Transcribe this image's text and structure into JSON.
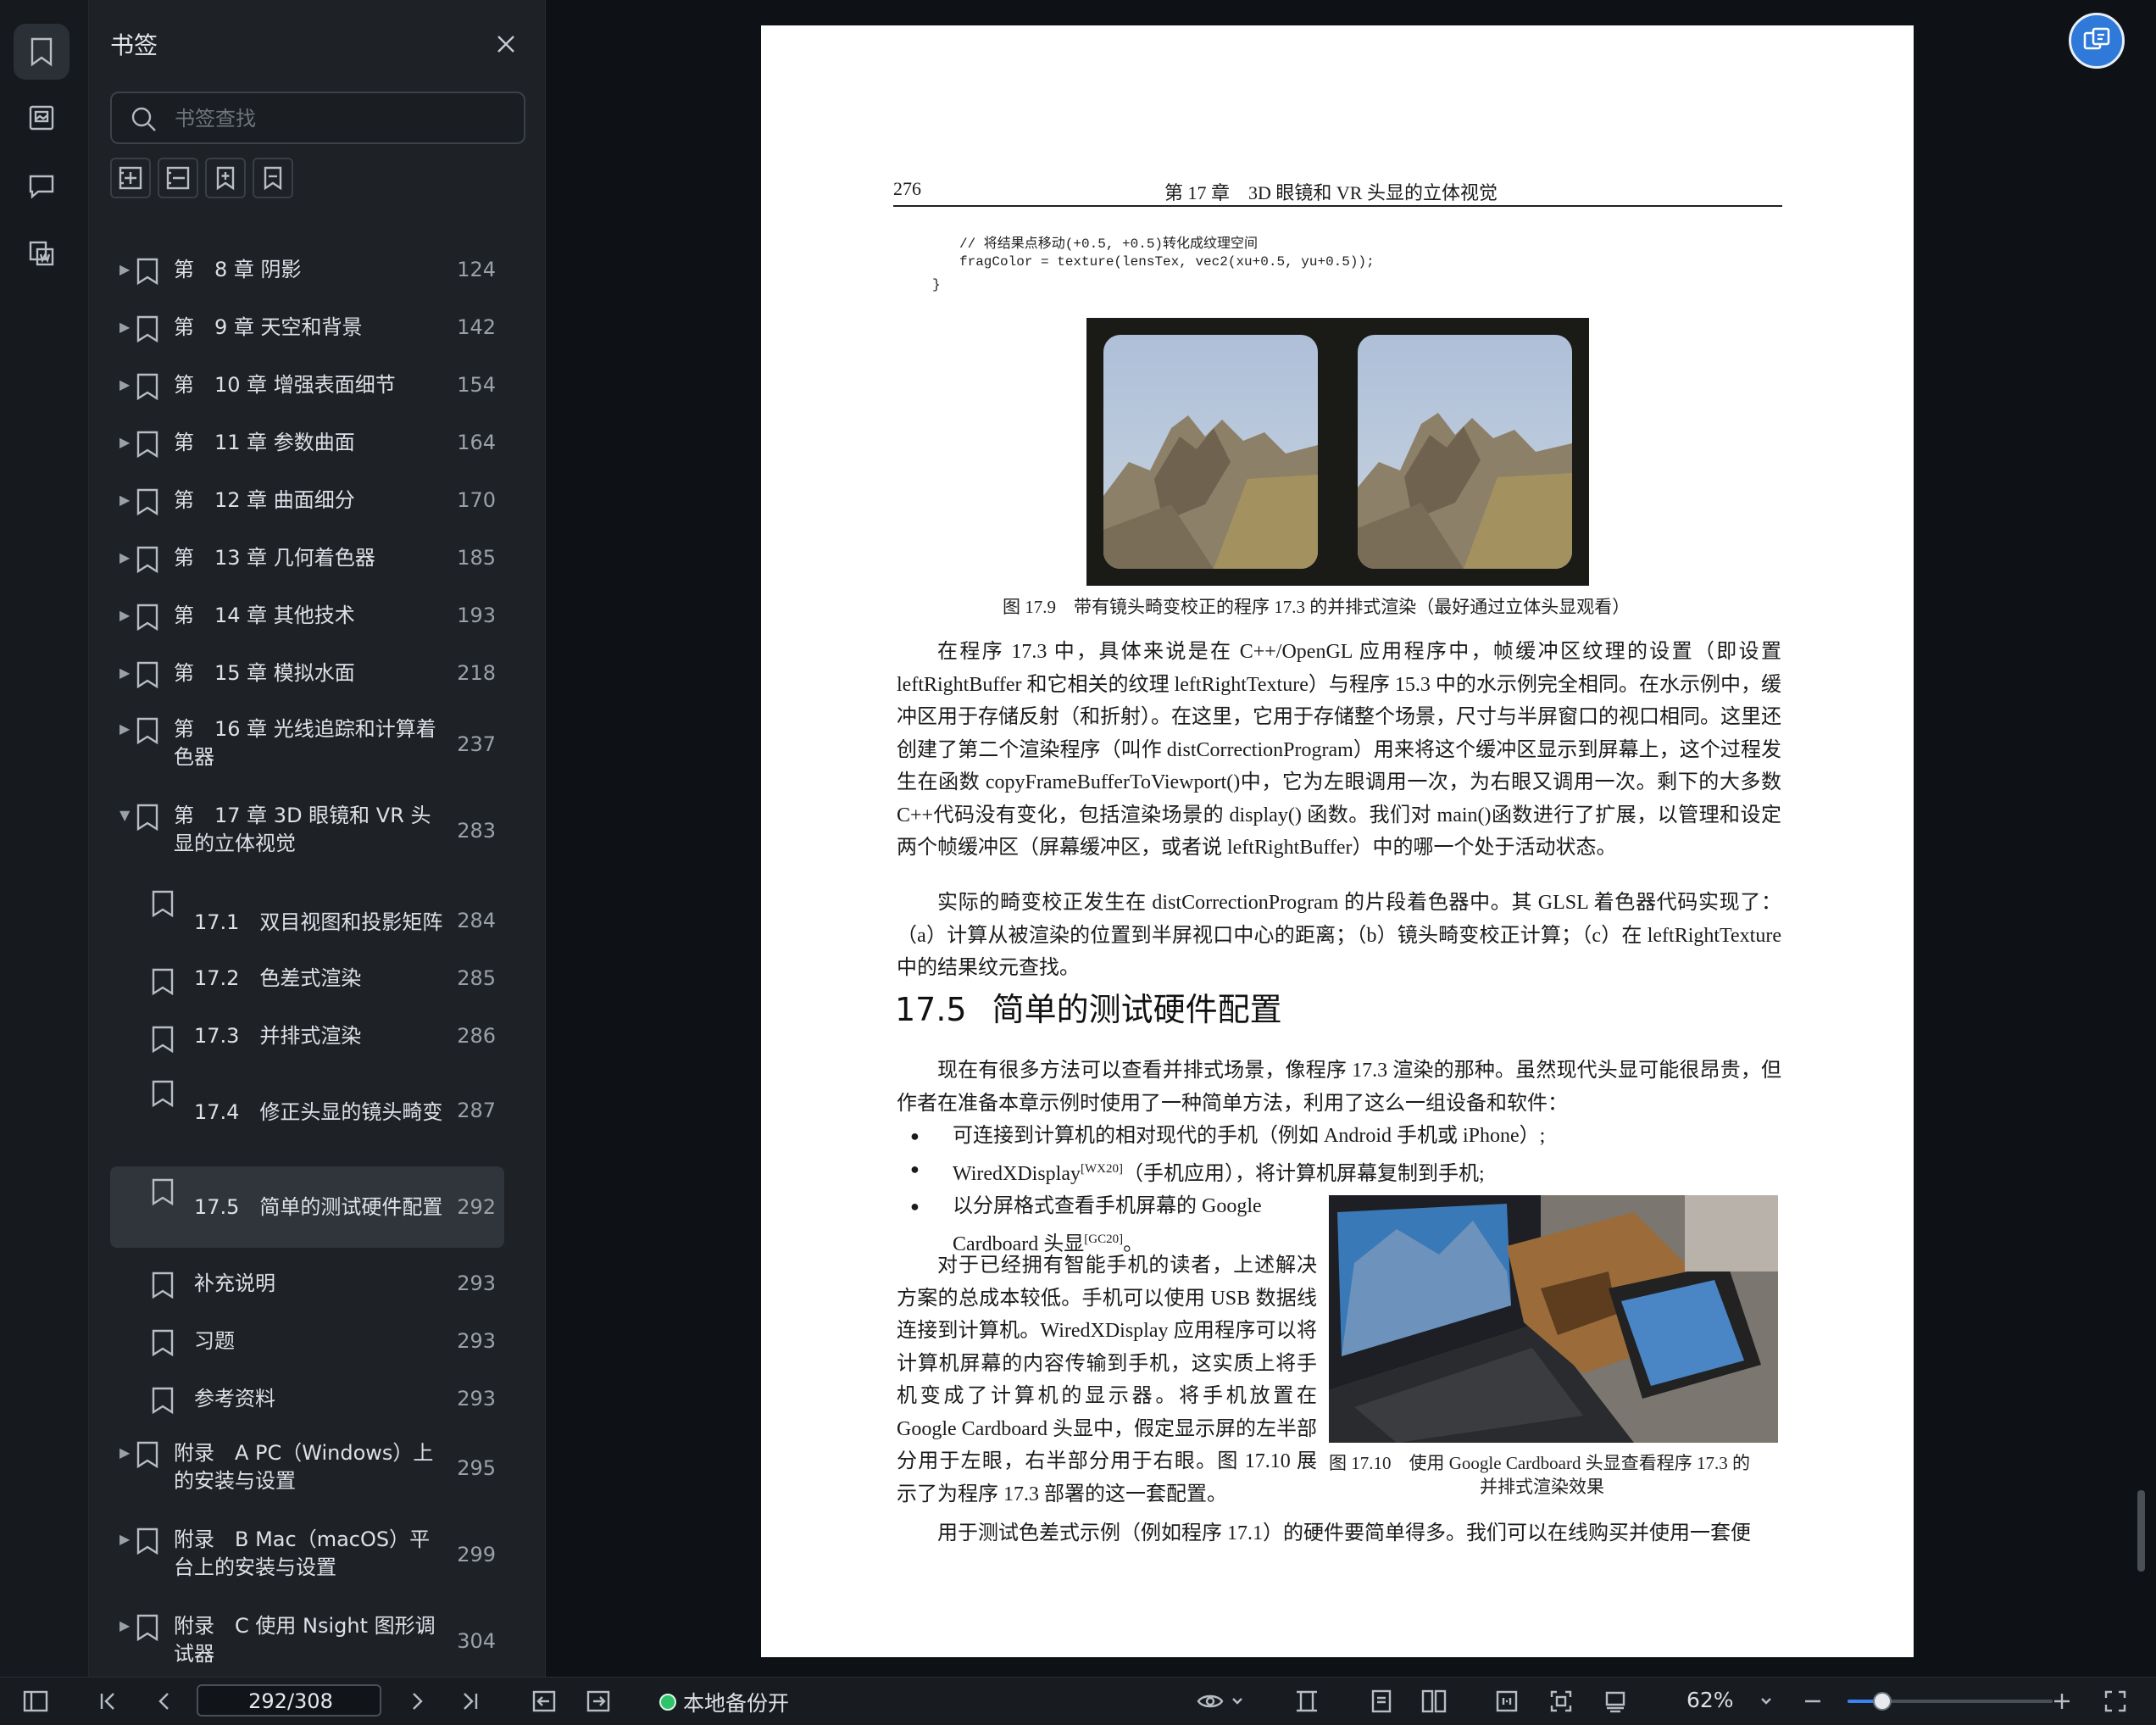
{
  "sidebar": {
    "title": "书签",
    "search_placeholder": "书签查找",
    "items": [
      {
        "label": "第　8 章 阴影",
        "page": "124"
      },
      {
        "label": "第　9 章 天空和背景",
        "page": "142"
      },
      {
        "label": "第　10 章 增强表面细节",
        "page": "154"
      },
      {
        "label": "第　11 章 参数曲面",
        "page": "164"
      },
      {
        "label": "第　12 章 曲面细分",
        "page": "170"
      },
      {
        "label": "第　13 章 几何着色器",
        "page": "185"
      },
      {
        "label": "第　14 章 其他技术",
        "page": "193"
      },
      {
        "label": "第　15 章 模拟水面",
        "page": "218"
      },
      {
        "label": "第　16 章 光线追踪和计算着色器",
        "page": "237"
      },
      {
        "label": "第　17 章 3D 眼镜和 VR 头显的立体视觉",
        "page": "283"
      },
      {
        "label": "17.1　双目视图和投影矩阵",
        "page": "284"
      },
      {
        "label": "17.2　色差式渲染",
        "page": "285"
      },
      {
        "label": "17.3　并排式渲染",
        "page": "286"
      },
      {
        "label": "17.4　修正头显的镜头畸变",
        "page": "287"
      },
      {
        "label": "17.5　简单的测试硬件配置",
        "page": "292"
      },
      {
        "label": "补充说明",
        "page": "293"
      },
      {
        "label": "习题",
        "page": "293"
      },
      {
        "label": "参考资料",
        "page": "293"
      },
      {
        "label": "附录　A PC（Windows）上的安装与设置",
        "page": "295"
      },
      {
        "label": "附录　B Mac（macOS）平台上的安装与设置",
        "page": "299"
      },
      {
        "label": "附录　C 使用 Nsight 图形调试器",
        "page": "304"
      }
    ]
  },
  "document": {
    "page_number": "276",
    "running_title": "第 17 章　3D 眼镜和 VR 头显的立体视觉",
    "code": [
      "// 将结果点移动(+0.5, +0.5)转化成纹理空间",
      "fragColor = texture(lensTex, vec2(xu+0.5, yu+0.5));",
      "}"
    ],
    "fig1_caption": "图 17.9　带有镜头畸变校正的程序 17.3 的并排式渲染（最好通过立体头显观看）",
    "para1": "在程序 17.3 中，具体来说是在 C++/OpenGL 应用程序中，帧缓冲区纹理的设置（即设置 leftRightBuffer 和它相关的纹理 leftRightTexture）与程序 15.3 中的水示例完全相同。在水示例中，缓冲区用于存储反射（和折射）。在这里，它用于存储整个场景，尺寸与半屏窗口的视口相同。这里还创建了第二个渲染程序（叫作 distCorrectionProgram）用来将这个缓冲区显示到屏幕上，这个过程发生在函数 copyFrameBufferToViewport()中，它为左眼调用一次，为右眼又调用一次。剩下的大多数 C++代码没有变化，包括渲染场景的 display() 函数。我们对 main()函数进行了扩展，以管理和设定两个帧缓冲区（屏幕缓冲区，或者说 leftRightBuffer）中的哪一个处于活动状态。",
    "para2": "实际的畸变校正发生在 distCorrectionProgram 的片段着色器中。其 GLSL 着色器代码实现了：（a）计算从被渲染的位置到半屏视口中心的距离；（b）镜头畸变校正计算；（c）在 leftRightTexture 中的结果纹元查找。",
    "section_num": "17.5",
    "section_title": "简单的测试硬件配置",
    "para3": "现在有很多方法可以查看并排式场景，像程序 17.3 渲染的那种。虽然现代头显可能很昂贵，但作者在准备本章示例时使用了一种简单方法，利用了这么一组设备和软件：",
    "bullet1": "可连接到计算机的相对现代的手机（例如 Android 手机或 iPhone）;",
    "bullet2_a": "WiredXDisplay",
    "bullet2_sup": "[WX20]",
    "bullet2_b": "（手机应用），将计算机屏幕复制到手机;",
    "bullet3_a": "以分屏格式查看手机屏幕的 Google Cardboard 头显",
    "bullet3_sup": "[GC20]",
    "bullet3_b": "。",
    "para4": "对于已经拥有智能手机的读者，上述解决方案的总成本较低。手机可以使用 USB 数据线连接到计算机。WiredXDisplay 应用程序可以将计算机屏幕的内容传输到手机，这实质上将手机变成了计算机的显示器。将手机放置在 Google Cardboard 头显中，假定显示屏的左半部分用于左眼，右半部分用于右眼。图 17.10 展示了为程序 17.3 部署的这一套配置。",
    "fig2_caption_1": "图 17.10　使用 Google Cardboard 头显查看程序 17.3 的",
    "fig2_caption_2": "并排式渲染效果",
    "para5": "用于测试色差式示例（例如程序 17.1）的硬件要简单得多。我们可以在线购买并使用一套便"
  },
  "statusbar": {
    "page_indicator": "292/308",
    "backup_label": "本地备份开",
    "zoom": "62%",
    "zoom_level_percent": 17
  },
  "colors": {
    "accent": "#3b82f6",
    "backup_on": "#2fc46b",
    "sidebar_bg": "#1e2126",
    "viewer_bg": "#0e1216"
  },
  "icons": {
    "rail": [
      "bookmark-icon",
      "thumbnail-icon",
      "comment-icon",
      "pdf-convert-icon"
    ],
    "sidebar_tools": [
      "expand-all-icon",
      "collapse-all-icon",
      "add-bookmark-icon",
      "bookmark-outline-icon"
    ],
    "statusbar": [
      "toggle-sidebar-icon",
      "first-page-icon",
      "prev-page-icon",
      "next-page-icon",
      "last-page-icon",
      "back-icon",
      "forward-icon",
      "eye-icon",
      "chevron-down-icon",
      "fit-height-icon",
      "single-page-icon",
      "two-page-icon",
      "fit-width-icon",
      "actual-size-icon",
      "rotate-icon",
      "zoom-out-icon",
      "zoom-in-icon",
      "fullscreen-icon"
    ]
  }
}
